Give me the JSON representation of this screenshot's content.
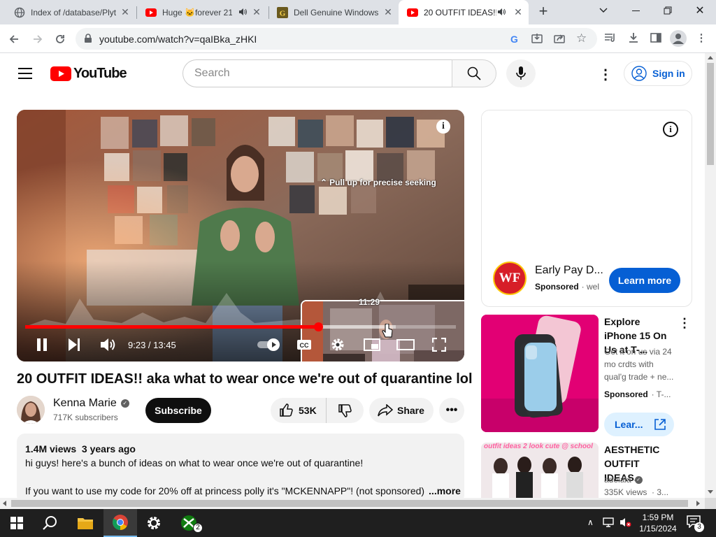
{
  "tabs": [
    {
      "title": "Index of /database/Plyt",
      "favicon": "globe-icon"
    },
    {
      "title": "Huge 🐱forever 21",
      "favicon": "youtube-icon",
      "audio": true
    },
    {
      "title": "Dell Genuine Windows",
      "favicon": "g-icon"
    },
    {
      "title": "20 OUTFIT IDEAS!!",
      "favicon": "youtube-icon",
      "audio": true,
      "active": true
    }
  ],
  "browser": {
    "url": "youtube.com/watch?v=qaIBka_zHKI"
  },
  "youtube": {
    "logo_text": "YouTube",
    "search_placeholder": "Search",
    "signin_label": "Sign in"
  },
  "player": {
    "seek_hint": "Pull up for precise seeking",
    "preview_time": "11:29",
    "time_display": "9:23 / 13:45",
    "progress_fraction": 0.68
  },
  "video": {
    "title": "20 OUTFIT IDEAS!! aka what to wear once we're out of quarantine lol",
    "channel": "Kenna Marie",
    "subscribers": "717K subscribers",
    "subscribe_label": "Subscribe",
    "likes": "53K",
    "share_label": "Share",
    "views_date": "1.4M views  3 years ago",
    "desc_line1": "hi guys! here's a bunch of ideas on what to wear once we're out of quarantine!",
    "desc_line2": "If you want to use my code for 20% off at princess polly it's \"MCKENNAPP\"! (not sponsored)",
    "more_label": "...more"
  },
  "sidebar": {
    "ad1": {
      "logo_text": "WF",
      "title": "Early Pay D...",
      "sponsored": "Sponsored",
      "domain": "· wel",
      "cta": "Learn more"
    },
    "ad2": {
      "title": "Explore iPhone 15 On Us at T-...",
      "body": "Get it on us via 24 mo crdts with qual'g trade + ne...",
      "sponsored": "Sponsored",
      "domain": "· T-...",
      "cta": "Lear..."
    },
    "video1": {
      "thumb_text": "outfit ideas 2 look cute @ school",
      "title": "AESTHETIC OUTFIT IDEAS...",
      "channel": "adelala",
      "meta": "335K views  · 3..."
    }
  },
  "taskbar": {
    "time": "1:59 PM",
    "date": "1/15/2024",
    "notification_count": "3",
    "xbox_badge": "2"
  }
}
